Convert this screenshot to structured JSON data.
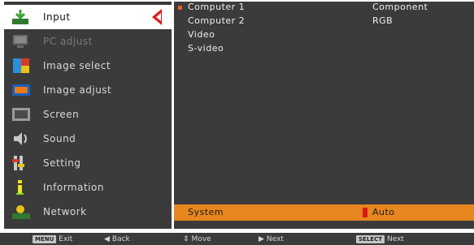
{
  "menu": {
    "items": [
      {
        "label": "Input",
        "icon": "input-icon",
        "selected": true
      },
      {
        "label": "PC adjust",
        "icon": "pc-adjust-icon",
        "dim": true
      },
      {
        "label": "Image select",
        "icon": "image-select-icon"
      },
      {
        "label": "Image adjust",
        "icon": "image-adjust-icon"
      },
      {
        "label": "Screen",
        "icon": "screen-icon"
      },
      {
        "label": "Sound",
        "icon": "sound-icon"
      },
      {
        "label": "Setting",
        "icon": "setting-icon"
      },
      {
        "label": "Information",
        "icon": "information-icon"
      },
      {
        "label": "Network",
        "icon": "network-icon"
      }
    ]
  },
  "panel": {
    "inputs": [
      {
        "label": "Computer 1",
        "selected": true,
        "value": "Component"
      },
      {
        "label": "Computer 2",
        "value": "RGB"
      },
      {
        "label": "Video"
      },
      {
        "label": "S-video"
      }
    ],
    "system": {
      "label": "System",
      "value": "Auto"
    }
  },
  "footer": {
    "exit": {
      "key": "MENU",
      "label": "Exit"
    },
    "back": {
      "label": "Back"
    },
    "move": {
      "label": "Move"
    },
    "next": {
      "label": "Next"
    },
    "select_next": {
      "key": "SELECT",
      "label": "Next"
    }
  },
  "colors": {
    "accent": "#e7861e",
    "pointer": "#e11919",
    "panel": "#3b3b3b"
  }
}
